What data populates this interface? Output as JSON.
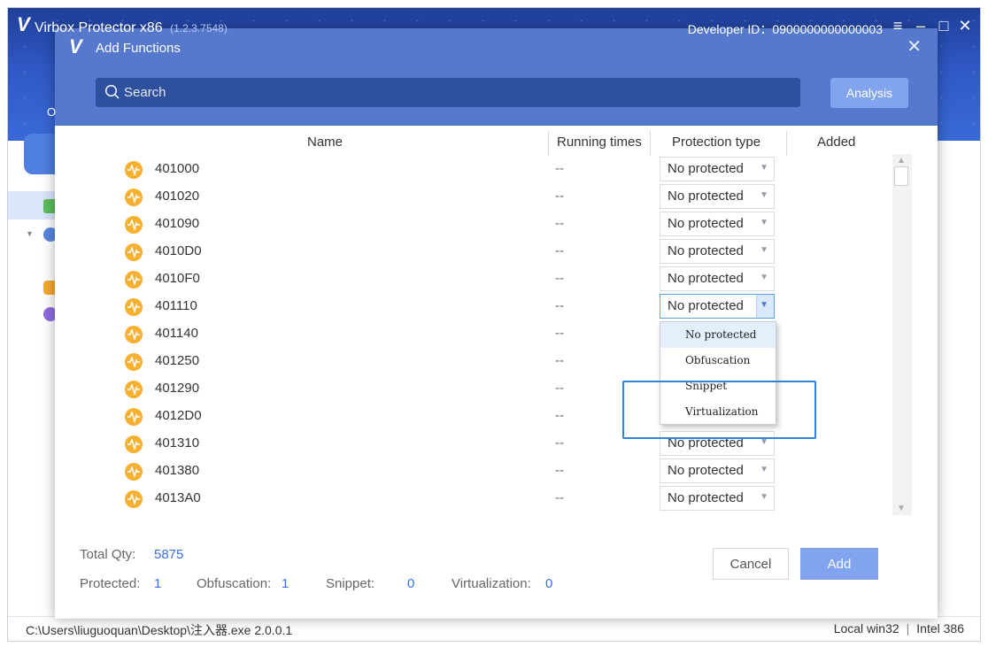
{
  "app": {
    "logo": "V",
    "title": "Virbox Protector x86",
    "version": "(1.2.3.7548)",
    "developer_id": "Developer ID：0900000000000003",
    "side_letter": "O"
  },
  "statusbar": {
    "path": "C:\\Users\\liuguoquan\\Desktop\\注入器.exe  2.0.0.1",
    "mode": "Local win32",
    "cpu": "Intel 386"
  },
  "dialog": {
    "logo": "V",
    "title": "Add Functions",
    "search_placeholder": "Search",
    "analysis_label": "Analysis",
    "columns": {
      "name": "Name",
      "running_times": "Running times",
      "protection_type": "Protection type",
      "added": "Added"
    },
    "rows": [
      {
        "name": "401000",
        "runs": "--",
        "protection": "No protected"
      },
      {
        "name": "401020",
        "runs": "--",
        "protection": "No protected"
      },
      {
        "name": "401090",
        "runs": "--",
        "protection": "No protected"
      },
      {
        "name": "4010D0",
        "runs": "--",
        "protection": "No protected"
      },
      {
        "name": "4010F0",
        "runs": "--",
        "protection": "No protected"
      },
      {
        "name": "401110",
        "runs": "--",
        "protection": "No protected"
      },
      {
        "name": "401140",
        "runs": "--",
        "protection": ""
      },
      {
        "name": "401250",
        "runs": "--",
        "protection": ""
      },
      {
        "name": "401290",
        "runs": "--",
        "protection": ""
      },
      {
        "name": "4012D0",
        "runs": "--",
        "protection": ""
      },
      {
        "name": "401310",
        "runs": "--",
        "protection": "No protected"
      },
      {
        "name": "401380",
        "runs": "--",
        "protection": "No protected"
      },
      {
        "name": "4013A0",
        "runs": "--",
        "protection": "No protected"
      }
    ],
    "dropdown_options": [
      "No protected",
      "Obfuscation",
      "Snippet",
      "Virtualization"
    ],
    "footer": {
      "total_label": "Total Qty:",
      "total_value": "5875",
      "protected_label": "Protected:",
      "protected_value": "1",
      "obfuscation_label": "Obfuscation:",
      "obfuscation_value": "1",
      "snippet_label": "Snippet:",
      "snippet_value": "0",
      "virtualization_label": "Virtualization:",
      "virtualization_value": "0"
    },
    "cancel_label": "Cancel",
    "add_label": "Add"
  },
  "colors": {
    "header_blue": "#2f58c4",
    "dialog_header": "#5679cd",
    "accent": "#3d70e0",
    "button_disabled": "#82a4ee",
    "function_icon": "#f7b02f",
    "annotation_box": "#2e86de"
  }
}
